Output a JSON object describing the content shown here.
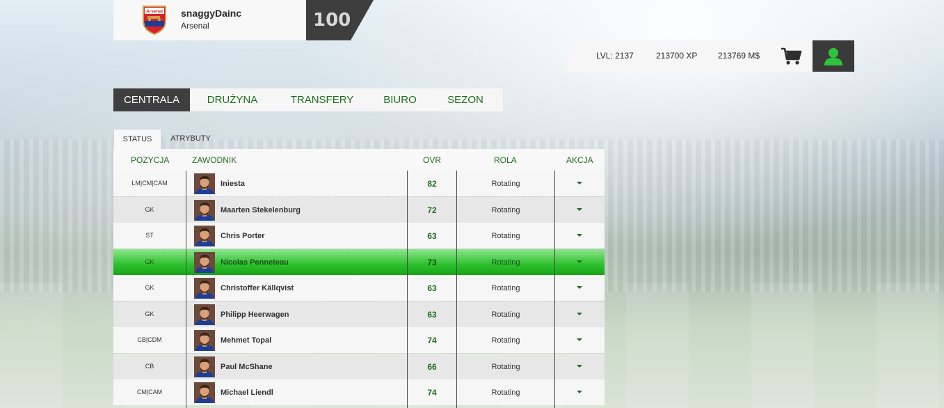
{
  "header": {
    "username": "snaggyDainc",
    "club": "Arsenal",
    "crest_text": "Arsenal",
    "rating": "100"
  },
  "stats": {
    "level": "LVL: 2137",
    "xp": "213700 XP",
    "money": "213769 M$"
  },
  "icons": {
    "cart": "cart-icon",
    "profile": "user-icon",
    "crest": "club-crest-icon"
  },
  "colors": {
    "accent": "#1e6e1e",
    "dark": "#3f3f3f",
    "selected": "#2cc02c"
  },
  "nav": {
    "tabs": [
      {
        "label": "CENTRALA",
        "active": true
      },
      {
        "label": "DRUŻYNA"
      },
      {
        "label": "TRANSFERY"
      },
      {
        "label": "BIURO"
      },
      {
        "label": "SEZON"
      }
    ]
  },
  "subtabs": [
    {
      "label": "STATUS",
      "active": true
    },
    {
      "label": "ATRYBUTY"
    }
  ],
  "table": {
    "headers": {
      "position": "POZYCJA",
      "player": "ZAWODNIK",
      "ovr": "OVR",
      "role": "ROLA",
      "action": "AKCJA"
    },
    "rows": [
      {
        "position": "LM|CM|CAM",
        "player": "Iniesta",
        "ovr": "82",
        "role": "Rotating"
      },
      {
        "position": "GK",
        "player": "Maarten Stekelenburg",
        "ovr": "72",
        "role": "Rotating"
      },
      {
        "position": "ST",
        "player": "Chris Porter",
        "ovr": "63",
        "role": "Rotating"
      },
      {
        "position": "GK",
        "player": "Nicolas Penneteau",
        "ovr": "73",
        "role": "Rotating",
        "selected": true
      },
      {
        "position": "GK",
        "player": "Christoffer Källqvist",
        "ovr": "63",
        "role": "Rotating"
      },
      {
        "position": "GK",
        "player": "Philipp Heerwagen",
        "ovr": "63",
        "role": "Rotating"
      },
      {
        "position": "CB|CDM",
        "player": "Mehmet Topal",
        "ovr": "74",
        "role": "Rotating"
      },
      {
        "position": "CB",
        "player": "Paul McShane",
        "ovr": "66",
        "role": "Rotating"
      },
      {
        "position": "CM|CAM",
        "player": "Michael Liendl",
        "ovr": "74",
        "role": "Rotating"
      }
    ]
  }
}
